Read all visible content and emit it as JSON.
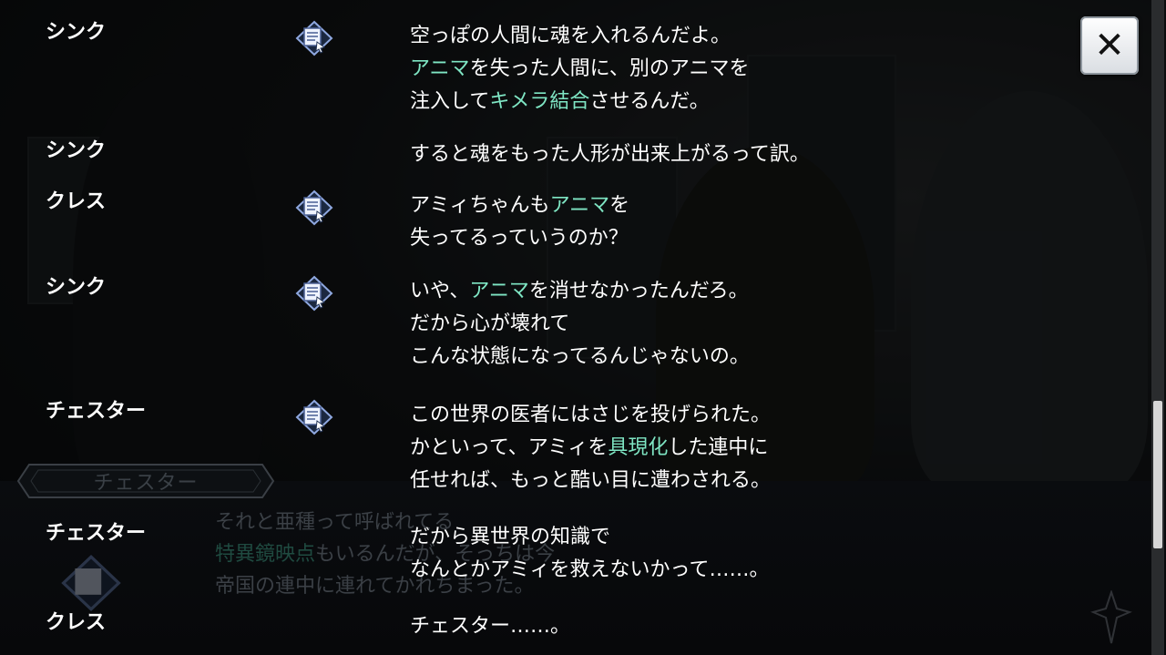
{
  "close_button": {
    "label": "✕"
  },
  "entries": [
    {
      "speaker": "シンク",
      "voice": true,
      "lines": [
        [
          {
            "t": "空っぽの人間に魂を入れるんだよ。"
          }
        ],
        [
          {
            "t": "アニマ",
            "h": true
          },
          {
            "t": "を失った人間に、別のアニマを"
          }
        ],
        [
          {
            "t": "注入して"
          },
          {
            "t": "キメラ結合",
            "h": true
          },
          {
            "t": "させるんだ。"
          }
        ]
      ]
    },
    {
      "speaker": "シンク",
      "voice": false,
      "lines": [
        [
          {
            "t": "すると魂をもった人形が出来上がるって訳。"
          }
        ]
      ]
    },
    {
      "speaker": "クレス",
      "voice": true,
      "lines": [
        [
          {
            "t": "アミィちゃんも"
          },
          {
            "t": "アニマ",
            "h": true
          },
          {
            "t": "を"
          }
        ],
        [
          {
            "t": "失ってるっていうのか？"
          }
        ]
      ]
    },
    {
      "speaker": "シンク",
      "voice": true,
      "lines": [
        [
          {
            "t": "いや、"
          },
          {
            "t": "アニマ",
            "h": true
          },
          {
            "t": "を消せなかったんだろ。"
          }
        ],
        [
          {
            "t": "だから心が壊れて"
          }
        ],
        [
          {
            "t": "こんな状態になってるんじゃないの。"
          }
        ]
      ]
    },
    {
      "speaker": "チェスター",
      "voice": true,
      "lines": [
        [
          {
            "t": "この世界の医者にはさじを投げられた。"
          }
        ],
        [
          {
            "t": "かといって、アミィを"
          },
          {
            "t": "具現化",
            "h": true
          },
          {
            "t": "した連中に"
          }
        ],
        [
          {
            "t": "任せれば、もっと酷い目に遭わされる。"
          }
        ]
      ]
    },
    {
      "speaker": "チェスター",
      "voice": false,
      "lines": [
        [
          {
            "t": "だから異世界の知識で"
          }
        ],
        [
          {
            "t": "なんとかアミィを救えないかって……。"
          }
        ]
      ]
    },
    {
      "speaker": "クレス",
      "voice": false,
      "lines": [
        [
          {
            "t": "チェスター……。"
          }
        ]
      ]
    }
  ],
  "underlying_textbox": {
    "speaker": "チェスター",
    "lines": [
      [
        {
          "t": "それと亜種って呼ばれてる"
        }
      ],
      [
        {
          "t": "特異鏡映点",
          "h": true
        },
        {
          "t": "もいるんだが、そっちは今"
        }
      ],
      [
        {
          "t": "帝国の連中に連れてかれちまった。"
        }
      ]
    ]
  },
  "colors": {
    "highlight": "#7fe6c4",
    "text": "#ffffff",
    "background": "#0b0d10"
  },
  "icons": {
    "voice": "voice-replay-icon",
    "close": "close-icon",
    "crest": "crest-icon"
  }
}
